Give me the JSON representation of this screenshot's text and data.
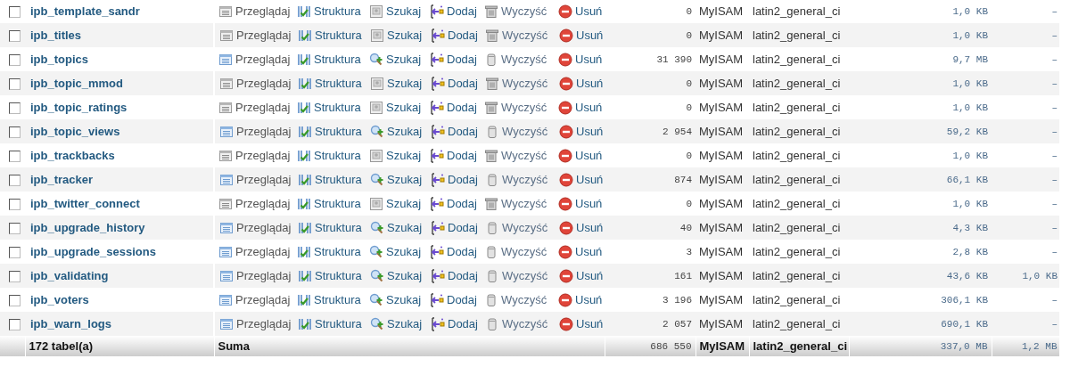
{
  "rows": [
    {
      "checked": false,
      "name": "ipb_template_sandr",
      "empty": true,
      "actions": [
        "Przeglądaj",
        "Struktura",
        "Szukaj",
        "Dodaj",
        "Wyczyść",
        "Usuń"
      ],
      "records": "0",
      "engine": "MyISAM",
      "collation": "latin2_general_ci",
      "size": "1,0 KB",
      "overhead": "–"
    },
    {
      "checked": false,
      "name": "ipb_titles",
      "empty": true,
      "actions": [
        "Przeglądaj",
        "Struktura",
        "Szukaj",
        "Dodaj",
        "Wyczyść",
        "Usuń"
      ],
      "records": "0",
      "engine": "MyISAM",
      "collation": "latin2_general_ci",
      "size": "1,0 KB",
      "overhead": "–"
    },
    {
      "checked": false,
      "name": "ipb_topics",
      "empty": false,
      "actions": [
        "Przeglądaj",
        "Struktura",
        "Szukaj",
        "Dodaj",
        "Wyczyść",
        "Usuń"
      ],
      "records": "31 390",
      "engine": "MyISAM",
      "collation": "latin2_general_ci",
      "size": "9,7 MB",
      "overhead": "–"
    },
    {
      "checked": false,
      "name": "ipb_topic_mmod",
      "empty": true,
      "actions": [
        "Przeglądaj",
        "Struktura",
        "Szukaj",
        "Dodaj",
        "Wyczyść",
        "Usuń"
      ],
      "records": "0",
      "engine": "MyISAM",
      "collation": "latin2_general_ci",
      "size": "1,0 KB",
      "overhead": "–"
    },
    {
      "checked": false,
      "name": "ipb_topic_ratings",
      "empty": true,
      "actions": [
        "Przeglądaj",
        "Struktura",
        "Szukaj",
        "Dodaj",
        "Wyczyść",
        "Usuń"
      ],
      "records": "0",
      "engine": "MyISAM",
      "collation": "latin2_general_ci",
      "size": "1,0 KB",
      "overhead": "–"
    },
    {
      "checked": false,
      "name": "ipb_topic_views",
      "empty": false,
      "actions": [
        "Przeglądaj",
        "Struktura",
        "Szukaj",
        "Dodaj",
        "Wyczyść",
        "Usuń"
      ],
      "records": "2 954",
      "engine": "MyISAM",
      "collation": "latin2_general_ci",
      "size": "59,2 KB",
      "overhead": "–"
    },
    {
      "checked": false,
      "name": "ipb_trackbacks",
      "empty": true,
      "actions": [
        "Przeglądaj",
        "Struktura",
        "Szukaj",
        "Dodaj",
        "Wyczyść",
        "Usuń"
      ],
      "records": "0",
      "engine": "MyISAM",
      "collation": "latin2_general_ci",
      "size": "1,0 KB",
      "overhead": "–"
    },
    {
      "checked": false,
      "name": "ipb_tracker",
      "empty": false,
      "actions": [
        "Przeglądaj",
        "Struktura",
        "Szukaj",
        "Dodaj",
        "Wyczyść",
        "Usuń"
      ],
      "records": "874",
      "engine": "MyISAM",
      "collation": "latin2_general_ci",
      "size": "66,1 KB",
      "overhead": "–"
    },
    {
      "checked": false,
      "name": "ipb_twitter_connect",
      "empty": true,
      "actions": [
        "Przeglądaj",
        "Struktura",
        "Szukaj",
        "Dodaj",
        "Wyczyść",
        "Usuń"
      ],
      "records": "0",
      "engine": "MyISAM",
      "collation": "latin2_general_ci",
      "size": "1,0 KB",
      "overhead": "–"
    },
    {
      "checked": false,
      "name": "ipb_upgrade_history",
      "empty": false,
      "actions": [
        "Przeglądaj",
        "Struktura",
        "Szukaj",
        "Dodaj",
        "Wyczyść",
        "Usuń"
      ],
      "records": "40",
      "engine": "MyISAM",
      "collation": "latin2_general_ci",
      "size": "4,3 KB",
      "overhead": "–"
    },
    {
      "checked": false,
      "name": "ipb_upgrade_sessions",
      "empty": false,
      "actions": [
        "Przeglądaj",
        "Struktura",
        "Szukaj",
        "Dodaj",
        "Wyczyść",
        "Usuń"
      ],
      "records": "3",
      "engine": "MyISAM",
      "collation": "latin2_general_ci",
      "size": "2,8 KB",
      "overhead": "–"
    },
    {
      "checked": false,
      "name": "ipb_validating",
      "empty": false,
      "actions": [
        "Przeglądaj",
        "Struktura",
        "Szukaj",
        "Dodaj",
        "Wyczyść",
        "Usuń"
      ],
      "records": "161",
      "engine": "MyISAM",
      "collation": "latin2_general_ci",
      "size": "43,6 KB",
      "overhead": "1,0 KB"
    },
    {
      "checked": false,
      "name": "ipb_voters",
      "empty": false,
      "actions": [
        "Przeglądaj",
        "Struktura",
        "Szukaj",
        "Dodaj",
        "Wyczyść",
        "Usuń"
      ],
      "records": "3 196",
      "engine": "MyISAM",
      "collation": "latin2_general_ci",
      "size": "306,1 KB",
      "overhead": "–"
    },
    {
      "checked": false,
      "name": "ipb_warn_logs",
      "empty": false,
      "actions": [
        "Przeglądaj",
        "Struktura",
        "Szukaj",
        "Dodaj",
        "Wyczyść",
        "Usuń"
      ],
      "records": "2 057",
      "engine": "MyISAM",
      "collation": "latin2_general_ci",
      "size": "690,1 KB",
      "overhead": "–"
    }
  ],
  "footer": {
    "table_count": "172 tabel(a)",
    "label": "Suma",
    "records": "686 550",
    "engine": "MyISAM",
    "collation": "latin2_general_ci",
    "size": "337,0 MB",
    "overhead": "1,2 MB"
  }
}
